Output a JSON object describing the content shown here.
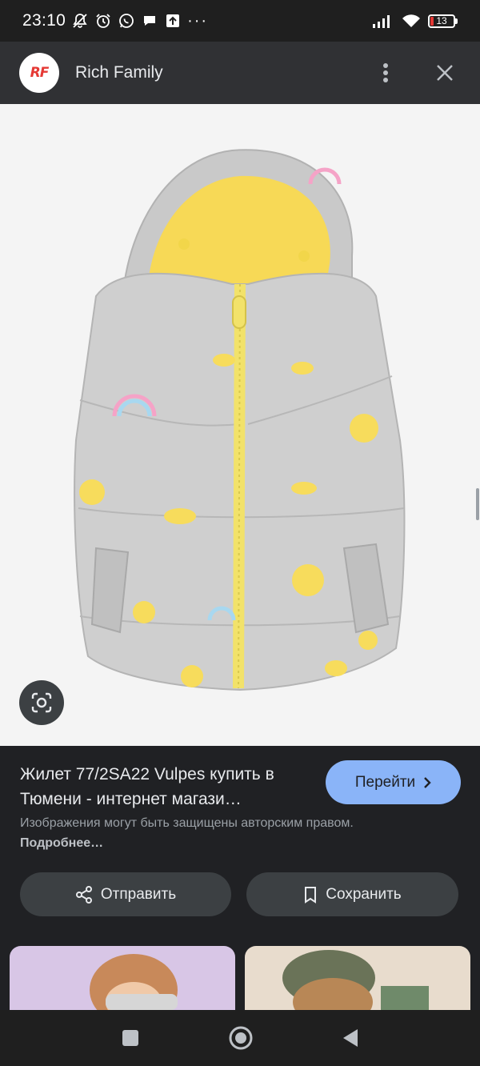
{
  "status_bar": {
    "time": "23:10",
    "battery": "13"
  },
  "header": {
    "site_name": "Rich Family",
    "logo_text": "RF"
  },
  "result": {
    "title": "Жилет 77/2SA22 Vulpes купить в Тюмени - интернет магази…",
    "visit_label": "Перейти",
    "copyright_text": "Изображения могут быть защищены авторским правом.",
    "more_link": "Подробнее…",
    "share_label": "Отправить",
    "save_label": "Сохранить"
  },
  "colors": {
    "accent": "#8ab4f8",
    "background": "#202124",
    "header": "#303134",
    "button": "#3c4043"
  },
  "icons": [
    "mute-icon",
    "alarm-icon",
    "whatsapp-icon",
    "chat-icon",
    "upload-icon",
    "signal-icon",
    "wifi-icon",
    "battery-icon",
    "more-vert-icon",
    "close-icon",
    "lens-icon",
    "share-icon",
    "bookmark-icon",
    "chevron-right-icon",
    "nav-recents-icon",
    "nav-home-icon",
    "nav-back-icon"
  ]
}
